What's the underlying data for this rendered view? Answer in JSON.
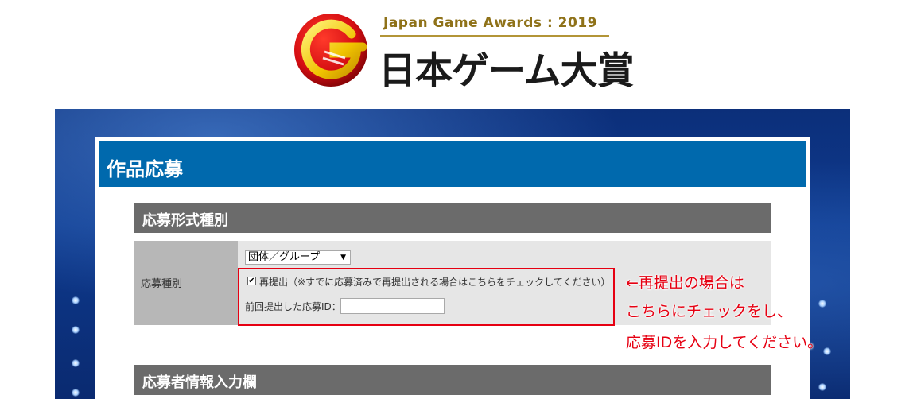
{
  "logo": {
    "en": "Japan Game Awards : 2019",
    "jp": "日本ゲーム大賞",
    "icon": "g-emblem-icon",
    "colors": {
      "red": "#d40d12",
      "gold": "#e8b700",
      "text_gold": "#8f7219"
    }
  },
  "page": {
    "title": "作品応募",
    "header_color": "#0069ad"
  },
  "section1": {
    "title": "応募形式種別"
  },
  "form": {
    "row_label": "応募種別",
    "select_value": "団体／グループ",
    "resubmit_checkbox": {
      "checked": true,
      "mark": "✔",
      "label": "再提出（※すでに応募済みで再提出される場合はこちらをチェックしてください）"
    },
    "previous_id_label": "前回提出した応募ID：",
    "previous_id_value": ""
  },
  "callout": {
    "line1": "←再提出の場合は",
    "line2": "こちらにチェックをし、",
    "line3": "応募IDを入力してください。",
    "color": "#e60012"
  },
  "section2": {
    "title": "応募者情報入力欄"
  }
}
